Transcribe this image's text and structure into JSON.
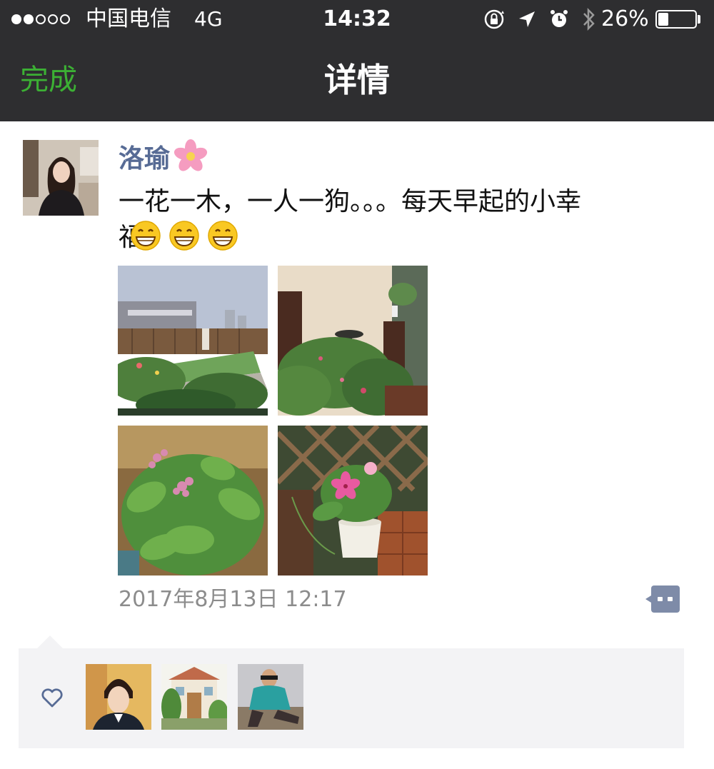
{
  "status_bar": {
    "carrier": "中国电信",
    "network": "4G",
    "time": "14:32",
    "battery_percent": "26%"
  },
  "nav": {
    "back_label": "完成",
    "title": "详情",
    "accent_color": "#3cb034"
  },
  "post": {
    "author": "洛瑜",
    "text_line1": "一花一木，一人一狗。。。每天早起的小幸",
    "text_line2": "福",
    "timestamp": "2017年8月13日 12:17",
    "photos": [
      "rooftop-garden",
      "flowers-by-lamp",
      "pink-flower-plant",
      "vinca-in-pot"
    ],
    "link_color": "#576b95"
  },
  "likes": {
    "avatars": [
      "liker-1",
      "liker-2",
      "liker-3"
    ]
  }
}
